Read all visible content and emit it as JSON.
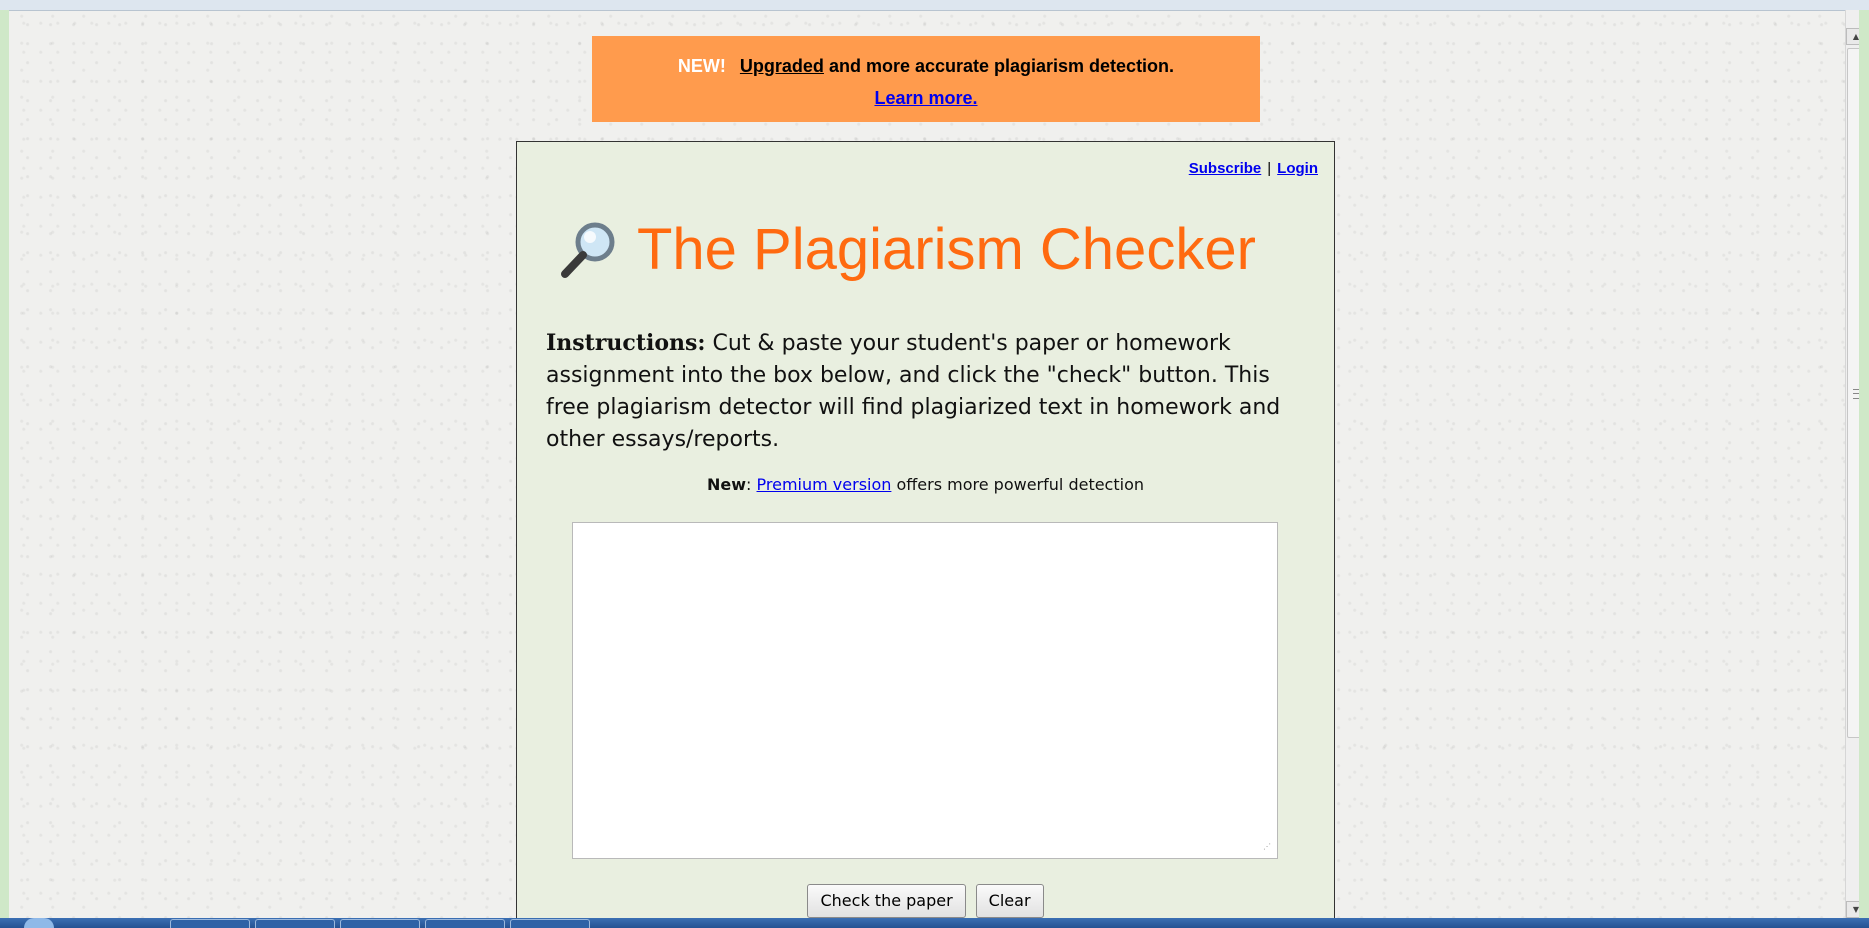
{
  "banner": {
    "new_label": "NEW!",
    "upgraded_label": "Upgraded",
    "text_rest": " and more accurate plagiarism detection.",
    "learn_more": "Learn more."
  },
  "header_links": {
    "subscribe": "Subscribe",
    "separator": "|",
    "login": "Login"
  },
  "title": "The Plagiarism Checker",
  "instructions": {
    "label": "Instructions:",
    "text": " Cut & paste your student's paper or homework assignment into the box below, and click the \"check\" button. This free plagiarism detector will find plagiarized text in homework and other essays/reports."
  },
  "new_note": {
    "label": "New",
    "colon": ": ",
    "link": "Premium version",
    "rest": " offers more powerful detection"
  },
  "paper_input": {
    "value": ""
  },
  "buttons": {
    "check": "Check the paper",
    "clear": "Clear"
  },
  "colors": {
    "banner_bg": "#ff9b4d",
    "title": "#ff6a10",
    "card_bg": "#e9efe0",
    "link": "#0000ee"
  },
  "icons": [
    "magnifying-glass-icon",
    "scroll-up-icon",
    "scroll-down-icon"
  ]
}
